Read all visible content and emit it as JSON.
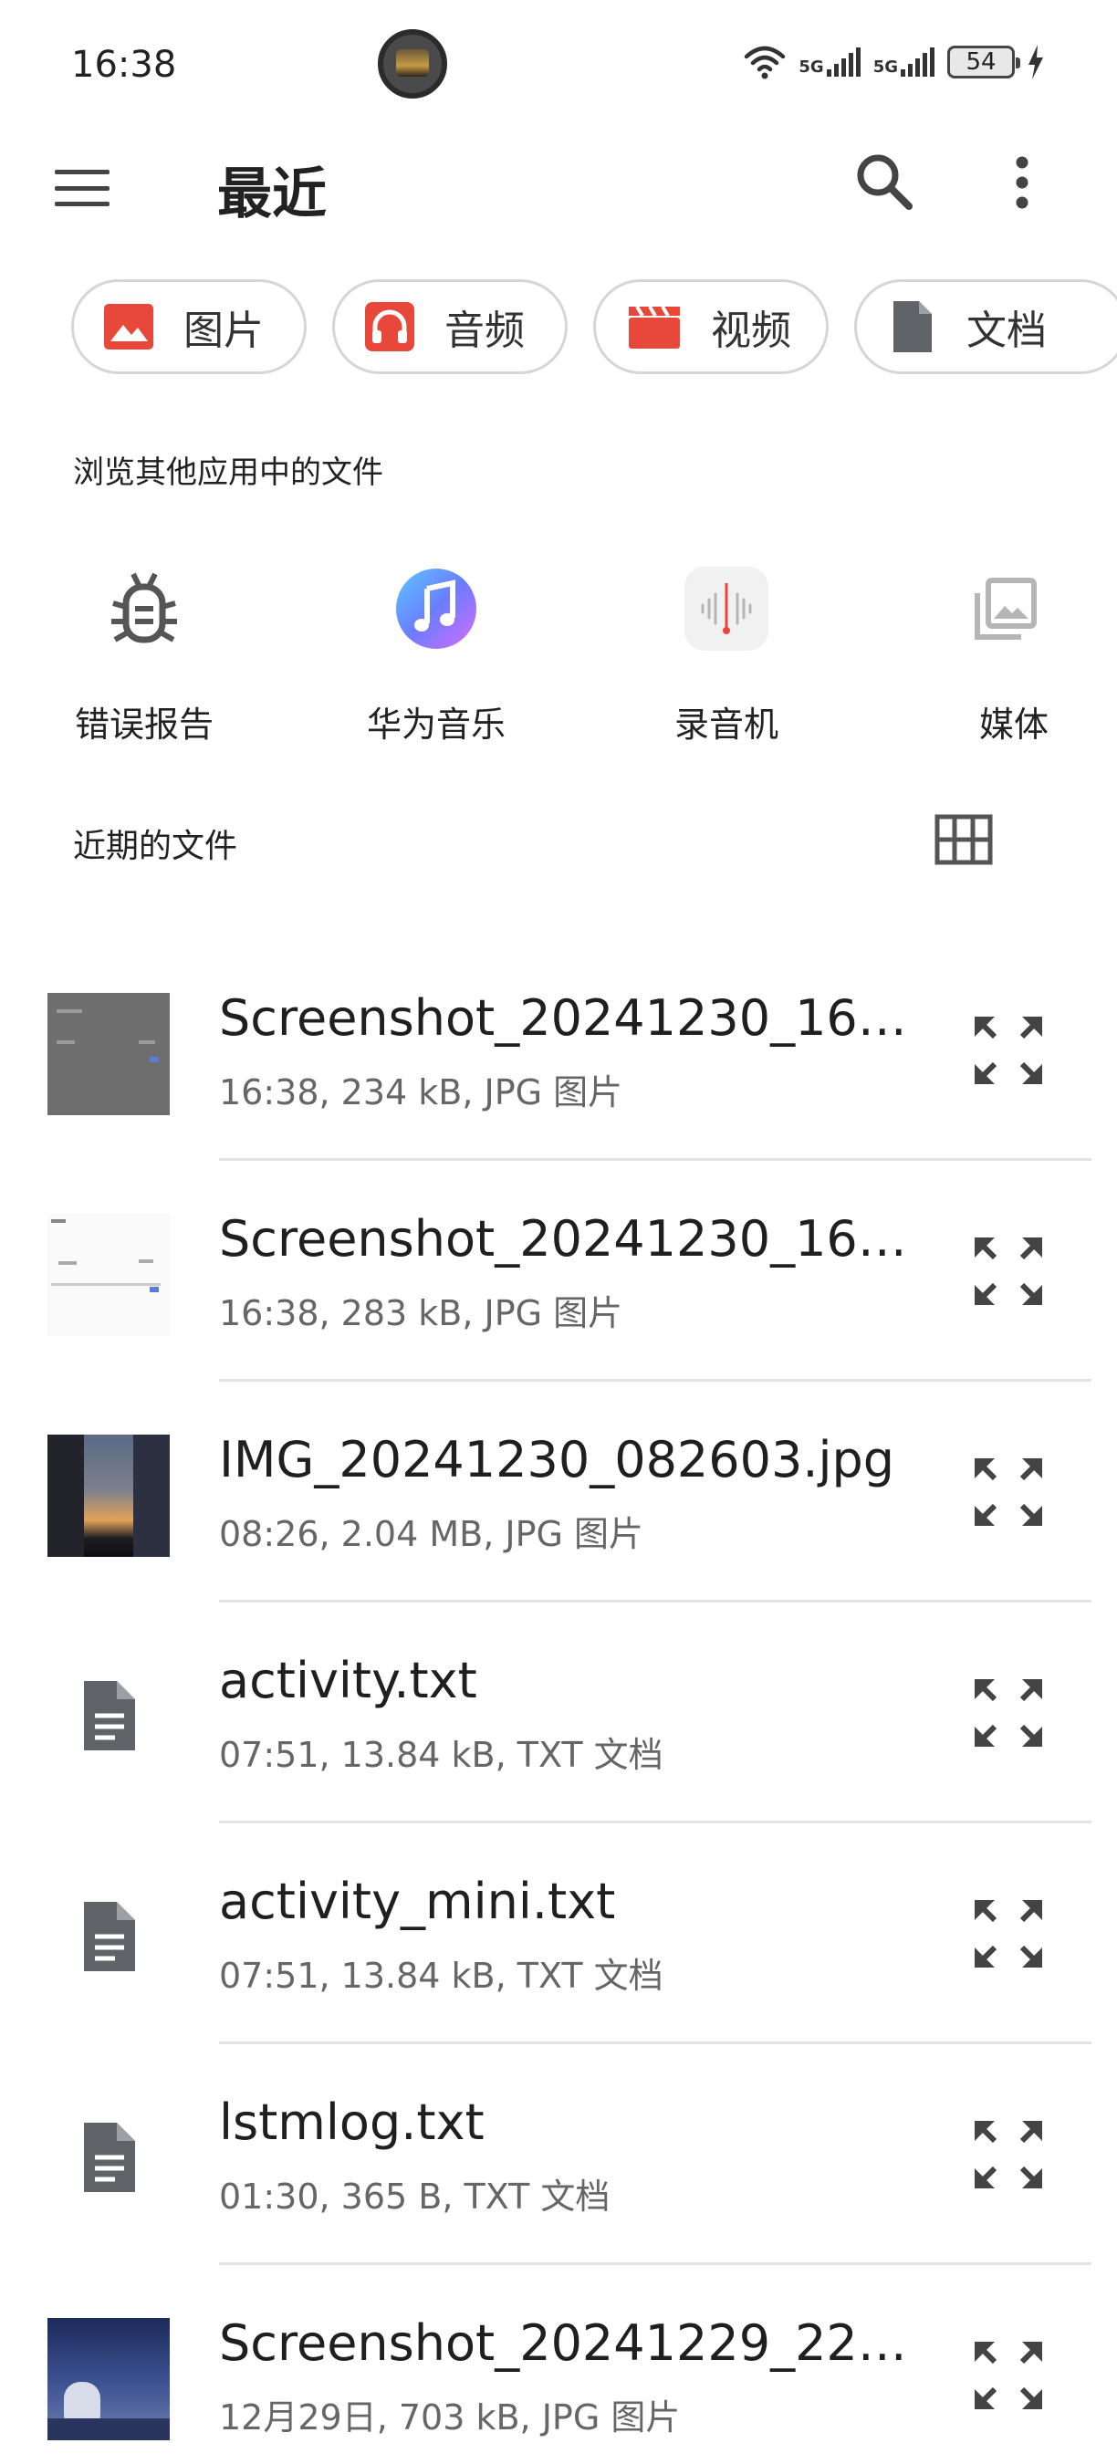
{
  "status_bar": {
    "time": "16:38",
    "network_1": "5G",
    "network_2": "5G",
    "battery": "54"
  },
  "toolbar": {
    "title": "最近"
  },
  "categories": [
    {
      "label": "图片",
      "icon": "image-icon",
      "color": "#e8483a"
    },
    {
      "label": "音频",
      "icon": "headphones-icon",
      "color": "#e8483a"
    },
    {
      "label": "视频",
      "icon": "clapperboard-icon",
      "color": "#e8483a"
    },
    {
      "label": "文档",
      "icon": "document-icon",
      "color": "#5f6368"
    }
  ],
  "browse": {
    "heading": "浏览其他应用中的文件",
    "apps": [
      {
        "label": "错误报告",
        "icon": "bug-icon"
      },
      {
        "label": "华为音乐",
        "icon": "music-note-icon"
      },
      {
        "label": "录音机",
        "icon": "sound-recorder-icon"
      },
      {
        "label": "媒体",
        "icon": "photo-library-icon"
      }
    ]
  },
  "recent": {
    "heading": "近期的文件",
    "files": [
      {
        "name": "Screenshot_20241230_16…",
        "meta": "16:38, 234 kB, JPG 图片",
        "kind": "image"
      },
      {
        "name": "Screenshot_20241230_16…",
        "meta": "16:38, 283 kB, JPG 图片",
        "kind": "image"
      },
      {
        "name": "IMG_20241230_082603.jpg",
        "meta": "08:26, 2.04 MB, JPG 图片",
        "kind": "image"
      },
      {
        "name": "activity.txt",
        "meta": "07:51, 13.84 kB, TXT 文档",
        "kind": "text"
      },
      {
        "name": "activity_mini.txt",
        "meta": "07:51, 13.84 kB, TXT 文档",
        "kind": "text"
      },
      {
        "name": "lstmlog.txt",
        "meta": "01:30, 365 B, TXT 文档",
        "kind": "text"
      },
      {
        "name": "Screenshot_20241229_22…",
        "meta": "12月29日, 703 kB, JPG 图片",
        "kind": "image"
      }
    ]
  }
}
